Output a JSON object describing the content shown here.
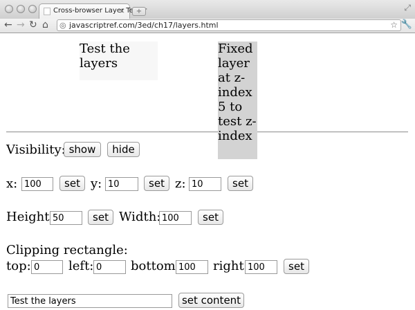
{
  "browser": {
    "tab_title": "Cross-browser Layer Tester",
    "tab_close": "×",
    "url": "javascriptref.com/3ed/ch17/layers.html"
  },
  "page": {
    "layer1_text": "Test the layers",
    "layer2_text": "Fixed layer at z-index 5 to test z-index",
    "visibility_label": "Visibility:",
    "show_label": "show",
    "hide_label": "hide",
    "x_label": "x:",
    "x_value": "100",
    "y_label": "y:",
    "y_value": "10",
    "z_label": "z:",
    "z_value": "10",
    "set_label": "set",
    "height_label": "Height:",
    "height_value": "50",
    "width_label": "Width:",
    "width_value": "100",
    "clipping_label": "Clipping rectangle:",
    "top_label": "top:",
    "top_value": "0",
    "left_label": "left:",
    "left_value": "0",
    "bottom_label": "bottom:",
    "bottom_value": "100",
    "right_label": "right:",
    "right_value": "100",
    "content_value": "Test the layers",
    "set_content_label": "set content"
  }
}
